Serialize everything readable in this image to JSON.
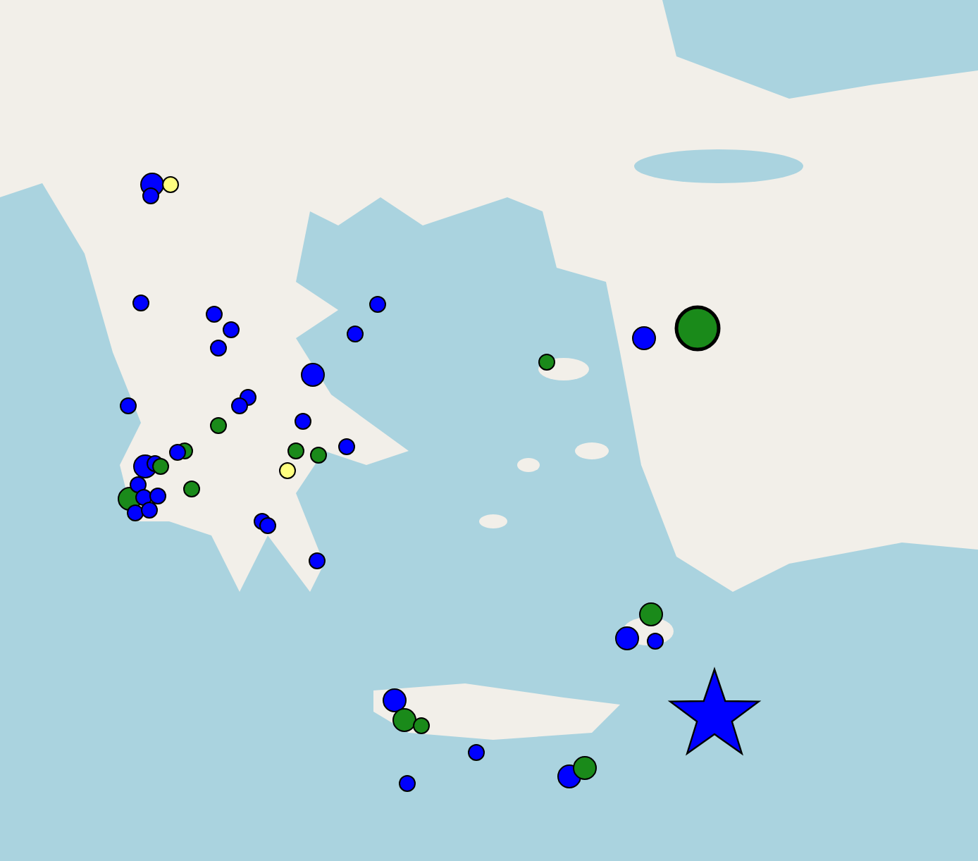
{
  "map": {
    "markers": [
      {
        "kind": "mid-dot",
        "color": "#0000ff"
      },
      {
        "kind": "dot",
        "color": "#0000ff"
      },
      {
        "kind": "dot",
        "color": "#ffff80"
      },
      {
        "kind": "dot",
        "color": "#0000ff"
      },
      {
        "kind": "dot",
        "color": "#0000ff"
      },
      {
        "kind": "dot",
        "color": "#0000ff"
      },
      {
        "kind": "dot",
        "color": "#0000ff"
      },
      {
        "kind": "dot",
        "color": "#0000ff"
      },
      {
        "kind": "dot",
        "color": "#0000ff"
      },
      {
        "kind": "mid-dot",
        "color": "#0000ff"
      },
      {
        "kind": "dot",
        "color": "#0000ff"
      },
      {
        "kind": "dot",
        "color": "#0000ff"
      },
      {
        "kind": "dot",
        "color": "#0000ff"
      },
      {
        "kind": "dot",
        "color": "#0000ff"
      },
      {
        "kind": "dot",
        "color": "#1a8a1a"
      },
      {
        "kind": "dot",
        "color": "#1a8a1a"
      },
      {
        "kind": "dot",
        "color": "#0000ff"
      },
      {
        "kind": "dot",
        "color": "#1a8a1a"
      },
      {
        "kind": "dot",
        "color": "#1a8a1a"
      },
      {
        "kind": "dot",
        "color": "#ffff80"
      },
      {
        "kind": "mid-dot",
        "color": "#0000ff"
      },
      {
        "kind": "dot",
        "color": "#0000ff"
      },
      {
        "kind": "dot",
        "color": "#1a8a1a"
      },
      {
        "kind": "dot",
        "color": "#1a8a1a"
      },
      {
        "kind": "mid-dot",
        "color": "#1a8a1a"
      },
      {
        "kind": "dot",
        "color": "#0000ff"
      },
      {
        "kind": "dot",
        "color": "#0000ff"
      },
      {
        "kind": "dot",
        "color": "#0000ff"
      },
      {
        "kind": "dot",
        "color": "#0000ff"
      },
      {
        "kind": "dot",
        "color": "#0000ff"
      },
      {
        "kind": "dot",
        "color": "#0000ff"
      },
      {
        "kind": "dot",
        "color": "#0000ff"
      },
      {
        "kind": "dot",
        "color": "#0000ff"
      },
      {
        "kind": "dot",
        "color": "#0000ff"
      },
      {
        "kind": "dot",
        "color": "#1a8a1a"
      },
      {
        "kind": "mid-dot",
        "color": "#0000ff"
      },
      {
        "kind": "big-dot",
        "color": "#1a8a1a"
      },
      {
        "kind": "mid-dot",
        "color": "#1a8a1a"
      },
      {
        "kind": "mid-dot",
        "color": "#0000ff"
      },
      {
        "kind": "dot",
        "color": "#0000ff"
      },
      {
        "kind": "mid-dot",
        "color": "#0000ff"
      },
      {
        "kind": "mid-dot",
        "color": "#1a8a1a"
      },
      {
        "kind": "dot",
        "color": "#1a8a1a"
      },
      {
        "kind": "dot",
        "color": "#0000ff"
      },
      {
        "kind": "dot",
        "color": "#0000ff"
      },
      {
        "kind": "mid-dot",
        "color": "#0000ff"
      },
      {
        "kind": "mid-dot",
        "color": "#1a8a1a"
      },
      {
        "kind": "star",
        "color": "#0000ff"
      }
    ]
  }
}
